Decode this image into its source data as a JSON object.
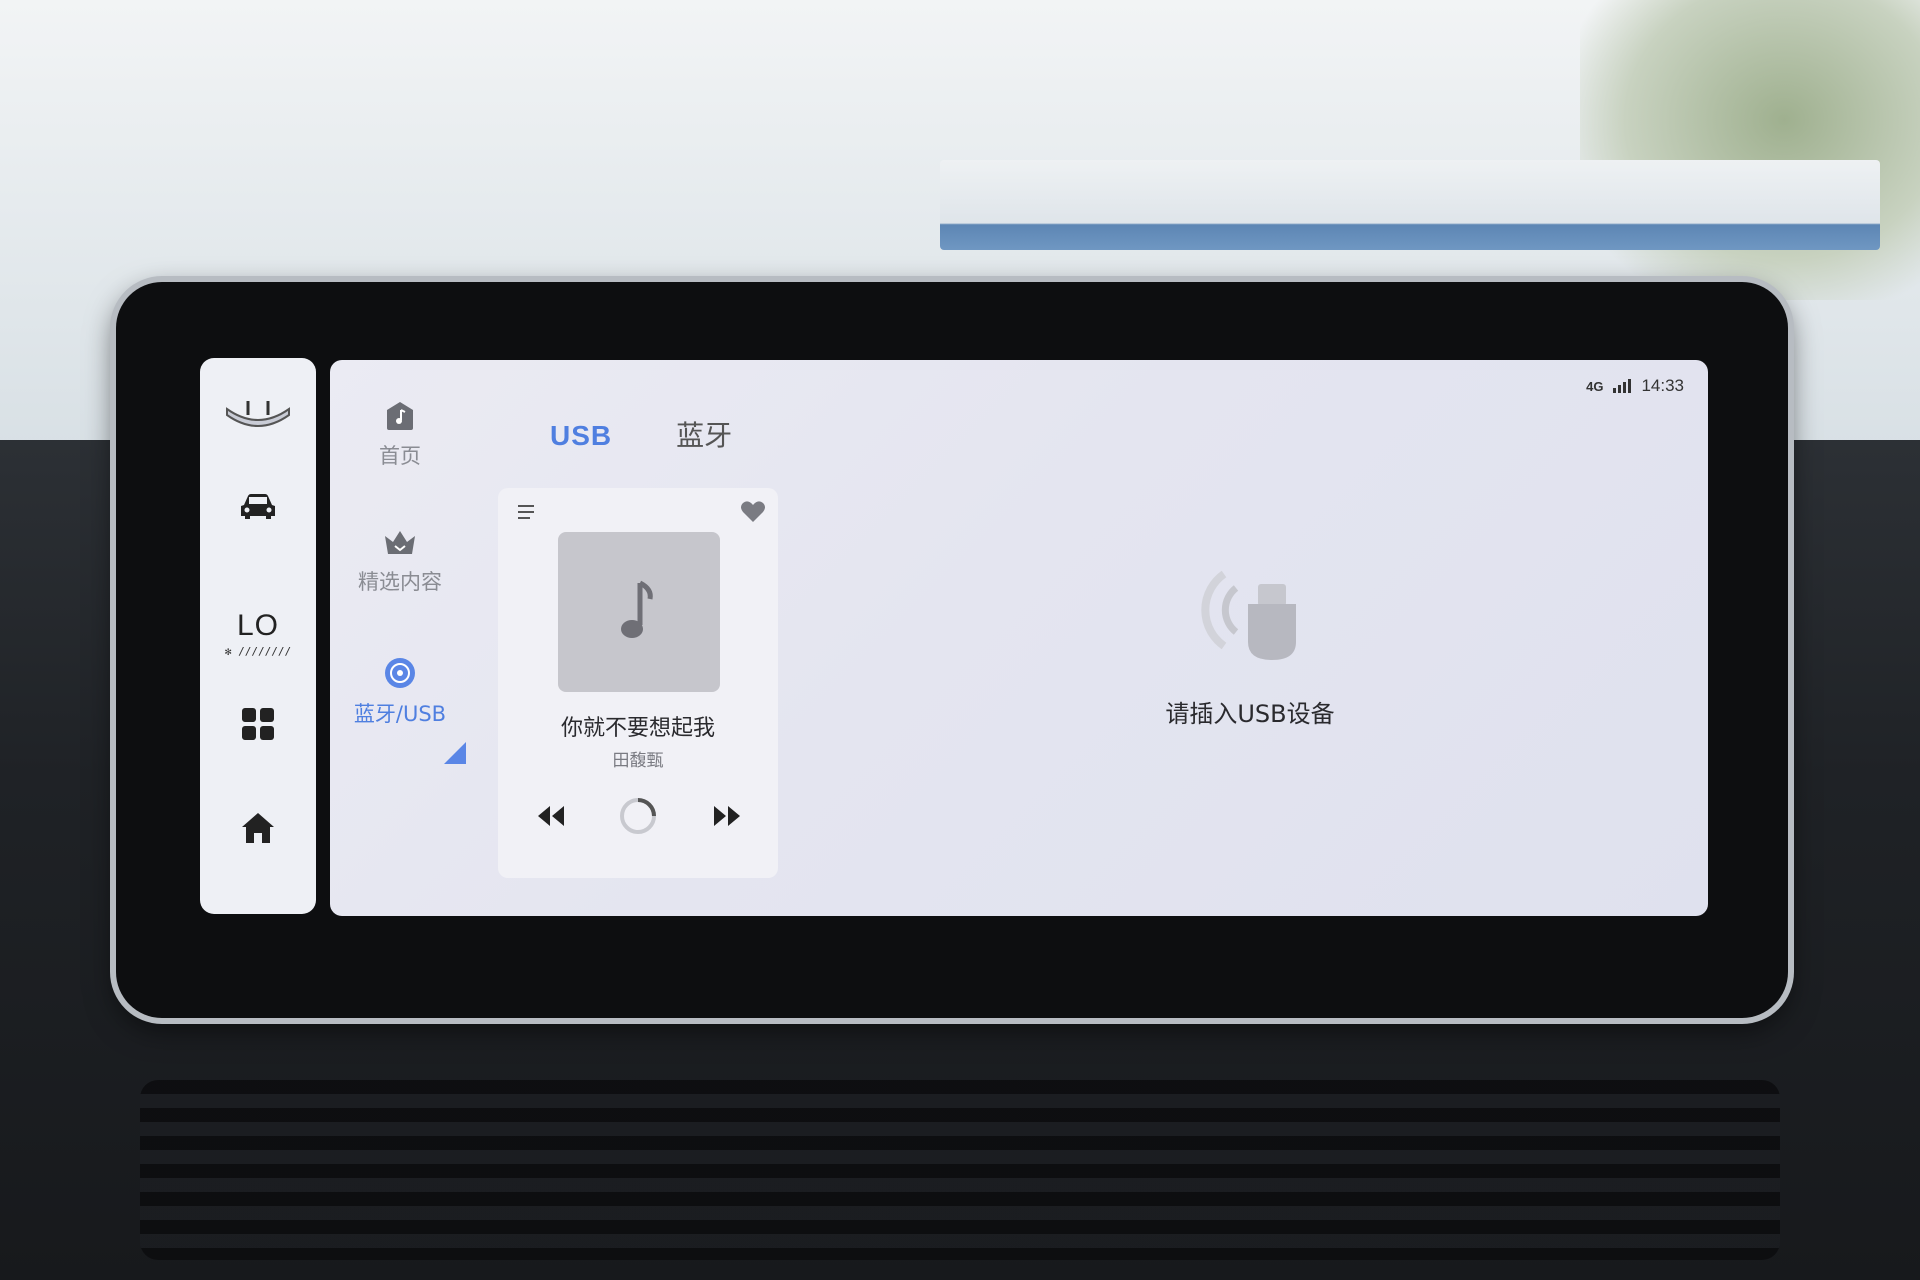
{
  "status_bar": {
    "network": "4G",
    "time": "14:33"
  },
  "side_strip": {
    "items": [
      {
        "icon": "wiper-icon"
      },
      {
        "icon": "car-icon"
      },
      {
        "icon": "ac-icon",
        "label": "LO"
      },
      {
        "icon": "apps-grid-icon"
      },
      {
        "icon": "home-icon"
      }
    ]
  },
  "nav": {
    "items": [
      {
        "label": "首页",
        "icon": "music-home-icon"
      },
      {
        "label": "精选内容",
        "icon": "crown-icon"
      },
      {
        "label": "蓝牙/USB",
        "icon": "disc-icon",
        "active": true
      }
    ]
  },
  "tabs": [
    {
      "label": "USB",
      "active": true
    },
    {
      "label": "蓝牙",
      "active": false
    }
  ],
  "player": {
    "song_title": "你就不要想起我",
    "artist": "田馥甄",
    "favorite": true
  },
  "usb_panel": {
    "message": "请插入USB设备",
    "icon": "usb-device-icon"
  },
  "colors": {
    "accent": "#4f7fe0",
    "screen_bg": "#e6e7f1",
    "card_bg": "#f1f1f6"
  }
}
